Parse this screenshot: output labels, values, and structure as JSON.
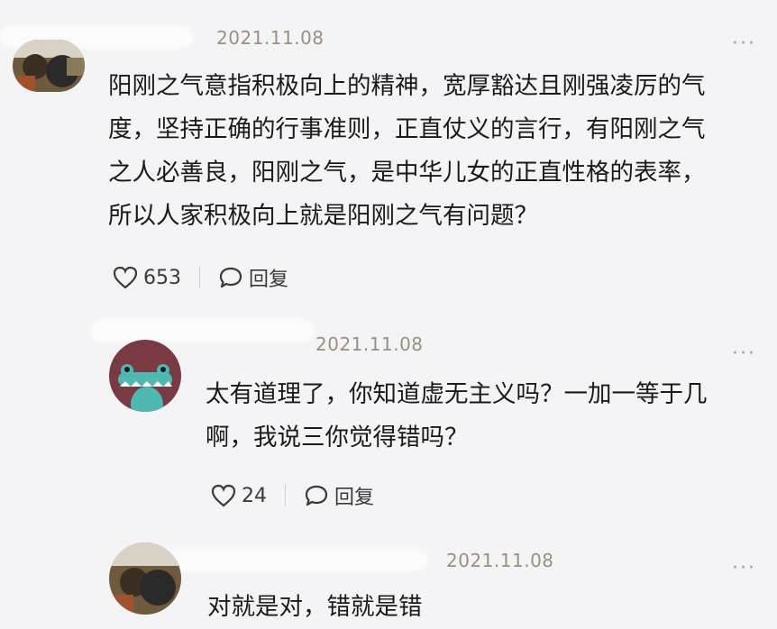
{
  "comments": [
    {
      "date": "2021.11.08",
      "text_lines": [
        "阳刚之气意指积极向上的精神，宽厚豁达且刚强凌厉的气",
        "度，坚持正确的行事准则，正直仗义的言行，有阳刚之气",
        "之人必善良，阳刚之气，是中华儿女的正直性格的表率，",
        "所以人家积极向上就是阳刚之气有问题？"
      ],
      "likes": "653",
      "reply_label": "回复",
      "more": "···"
    },
    {
      "date": "2021.11.08",
      "text_lines": [
        "太有道理了，你知道虚无主义吗？一加一等于几",
        "啊，我说三你觉得错吗？"
      ],
      "likes": "24",
      "reply_label": "回复",
      "more": "···"
    },
    {
      "date": "2021.11.08",
      "text_lines": [
        "对就是对，错就是错"
      ],
      "more": "···"
    }
  ],
  "colors": {
    "background": "#f4f4f6",
    "date": "#9a8f80",
    "text": "#1a1a1a",
    "avatar2_bg": "#7a3a44",
    "avatar2_croc": "#4fb8b0"
  },
  "icons": [
    "heart-icon",
    "comment-bubble-icon",
    "more-dots-icon"
  ]
}
